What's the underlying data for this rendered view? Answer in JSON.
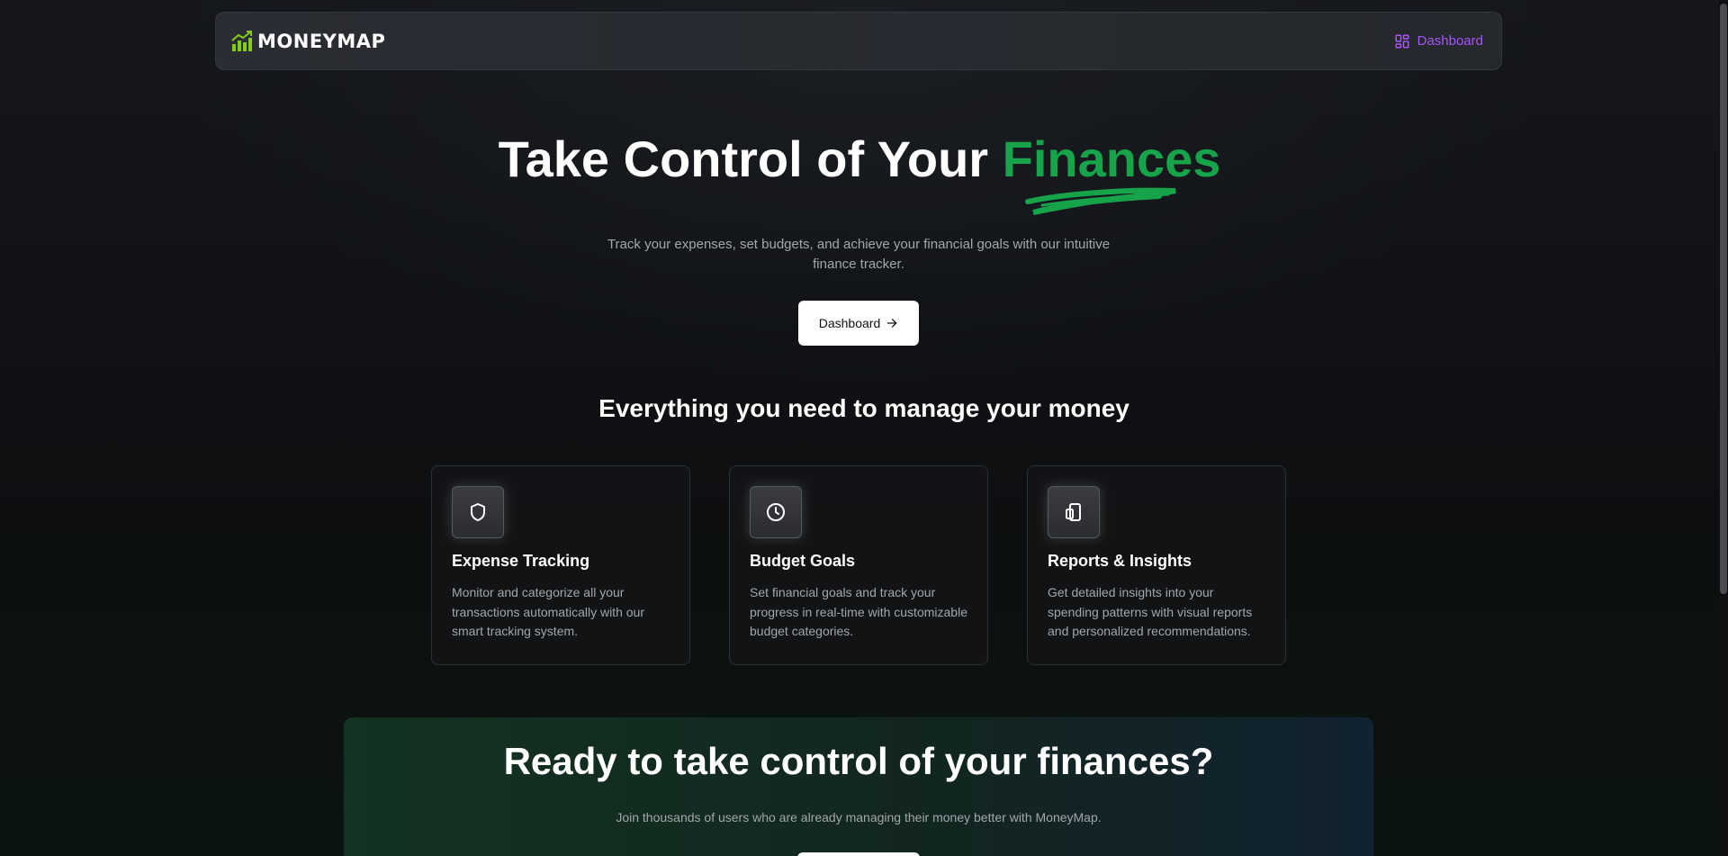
{
  "navbar": {
    "logo_text": "MONEYMAP",
    "dashboard_link": "Dashboard"
  },
  "hero": {
    "title_main": "Take Control of Your ",
    "title_accent": "Finances",
    "subtitle": "Track your expenses, set budgets, and achieve your financial goals with our intuitive finance tracker.",
    "button_label": "Dashboard"
  },
  "features": {
    "heading": "Everything you need to manage your money",
    "cards": [
      {
        "icon": "shield-icon",
        "title": "Expense Tracking",
        "description": "Monitor and categorize all your transactions automatically with our smart tracking system."
      },
      {
        "icon": "clock-icon",
        "title": "Budget Goals",
        "description": "Set financial goals and track your progress in real-time with customizable budget categories."
      },
      {
        "icon": "tablet-icon",
        "title": "Reports & Insights",
        "description": "Get detailed insights into your spending patterns with visual reports and personalized recommendations."
      }
    ]
  },
  "cta": {
    "title": "Ready to take control of your finances?",
    "subtitle": "Join thousands of users who are already managing their money better with MoneyMap."
  },
  "colors": {
    "accent_green": "#16a34a",
    "logo_green": "#84cc16",
    "nav_purple": "#a855f7"
  }
}
